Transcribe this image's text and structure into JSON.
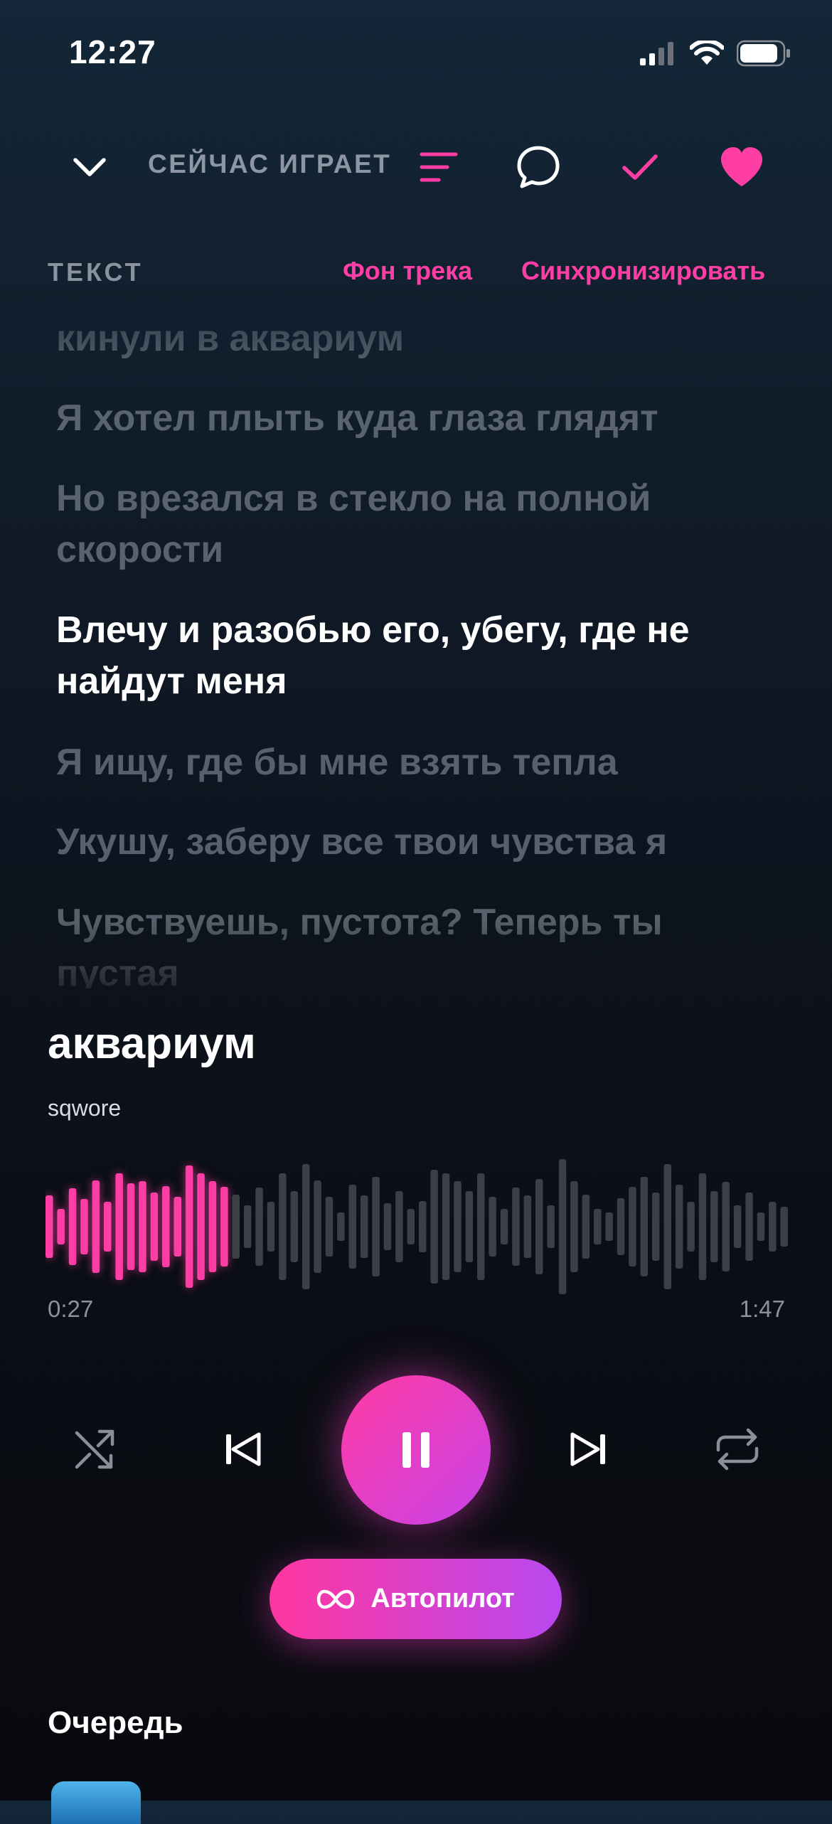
{
  "status_bar": {
    "time": "12:27"
  },
  "header": {
    "title": "СЕЙЧАС ИГРАЕТ"
  },
  "lyrics_header": {
    "label": "ТЕКСТ",
    "bg_track": "Фон трека",
    "sync": "Синхронизировать"
  },
  "lyrics": {
    "lines": [
      {
        "text": "кинули в аквариум",
        "active": false
      },
      {
        "text": "Я хотел плыть куда глаза глядят",
        "active": false
      },
      {
        "text": "Но врезался в стекло на полной скорости",
        "active": false
      },
      {
        "text": "Влечу и разобью его, убегу, где не найдут меня",
        "active": true
      },
      {
        "text": "Я ищу, где бы мне взять тепла",
        "active": false
      },
      {
        "text": "Укушу, заберу все твои чувства я",
        "active": false
      },
      {
        "text": "Чувствуешь, пустота? Теперь ты пустая",
        "active": false
      }
    ]
  },
  "track": {
    "title": "аквариум",
    "artist": "sqwore",
    "current_time": "0:27",
    "total_time": "1:47",
    "progress": 0.252
  },
  "colors": {
    "accent": "#ff3ea5",
    "accent_end": "#c843e8",
    "muted": "#8a929e",
    "wave_inactive": "#3c3f46"
  },
  "icons": {
    "collapse": "chevron-down-icon",
    "menu": "lines-icon",
    "comment": "chat-bubble-icon",
    "saved": "check-icon",
    "like": "heart-icon",
    "shuffle": "shuffle-icon",
    "prev": "skip-back-icon",
    "pause": "pause-icon",
    "next": "skip-forward-icon",
    "repeat": "repeat-icon",
    "autopilot": "infinity-icon"
  },
  "autopilot": {
    "label": "Автопилот"
  },
  "queue": {
    "title": "Очередь"
  }
}
